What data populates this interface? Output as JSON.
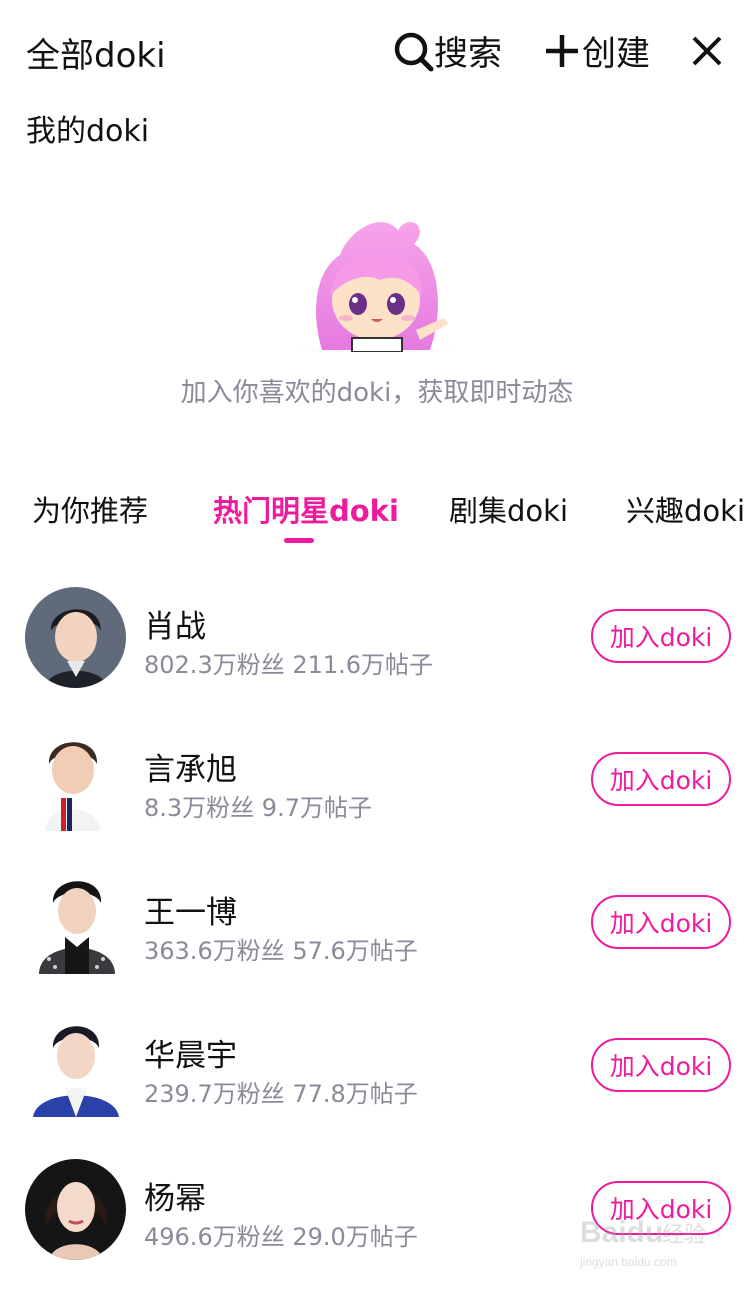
{
  "header": {
    "title": "全部doki",
    "search_label": "搜索",
    "create_label": "创建"
  },
  "my_doki": {
    "label": "我的doki",
    "empty_hint": "加入你喜欢的doki，获取即时动态"
  },
  "tabs": [
    {
      "label": "为你推荐",
      "active": false
    },
    {
      "label": "热门明星doki",
      "active": true
    },
    {
      "label": "剧集doki",
      "active": false
    },
    {
      "label": "兴趣doki",
      "active": false
    }
  ],
  "stars": [
    {
      "name": "肖战",
      "stats": "802.3万粉丝 211.6万帖子",
      "button": "加入doki"
    },
    {
      "name": "言承旭",
      "stats": "8.3万粉丝 9.7万帖子",
      "button": "加入doki"
    },
    {
      "name": "王一博",
      "stats": "363.6万粉丝 57.6万帖子",
      "button": "加入doki"
    },
    {
      "name": "华晨宇",
      "stats": "239.7万粉丝 77.8万帖子",
      "button": "加入doki"
    },
    {
      "name": "杨幂",
      "stats": "496.6万粉丝 29.0万帖子",
      "button": "加入doki"
    }
  ],
  "watermark": {
    "text": "Baidu经验",
    "subtext": "jingyan.baidu.com"
  },
  "colors": {
    "accent": "#ee1b9e",
    "secondary_text": "#8a8a99"
  }
}
